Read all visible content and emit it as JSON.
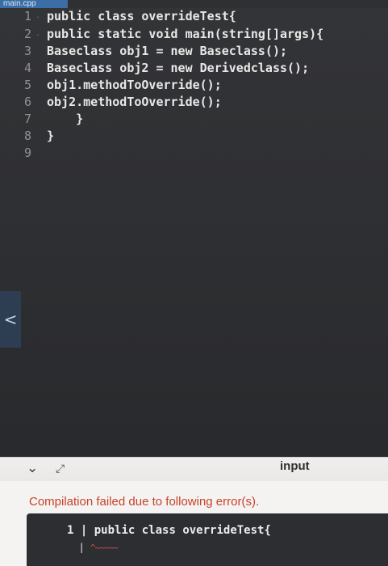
{
  "tab": {
    "file_name": "main.cpp"
  },
  "editor": {
    "line_numbers": [
      "1",
      "2",
      "3",
      "4",
      "5",
      "6",
      "7",
      "8",
      "9"
    ],
    "lines": [
      "public class overrideTest{",
      "public static void main(string[]args){",
      "Baseclass obj1 = new Baseclass();",
      "Baseclass obj2 = new Derivedclass();",
      "obj1.methodToOverride();",
      "obj2.methodToOverride();",
      "    }",
      "}",
      ""
    ]
  },
  "side": {
    "collapse_arrow": "<"
  },
  "panel": {
    "collapse_icon": "chevron-down-icon",
    "expand_icon": "expand-arrows-icon",
    "input_tab_label": "input",
    "error_title": "Compilation failed due to following error(s).",
    "error_line_number": "1",
    "error_separator": "|",
    "error_code": "public class overrideTest{",
    "error_caret_bar": "|",
    "error_caret": "^~~~~~"
  },
  "colors": {
    "error_text": "#c8412a",
    "tab_bg": "#3a6ea5"
  }
}
